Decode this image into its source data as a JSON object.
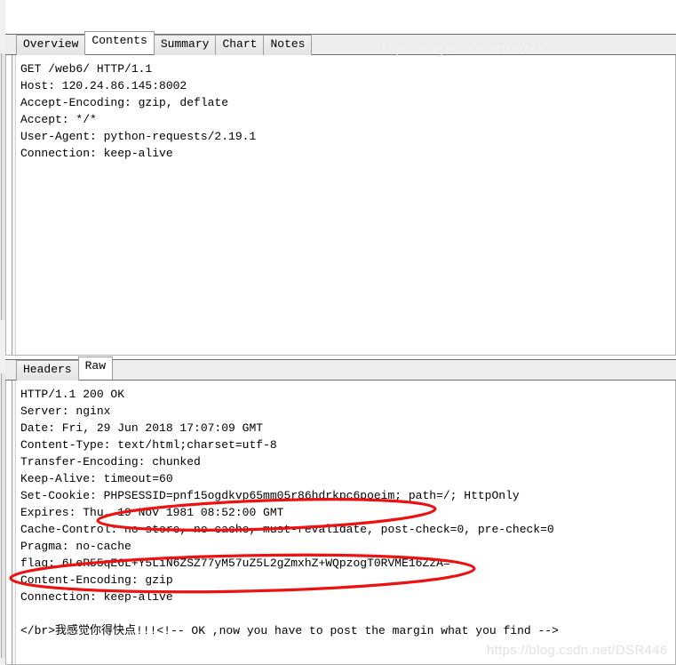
{
  "request_panel": {
    "tabs": [
      {
        "label": "Overview",
        "active": false
      },
      {
        "label": "Contents",
        "active": true
      },
      {
        "label": "Summary",
        "active": false
      },
      {
        "label": "Chart",
        "active": false
      },
      {
        "label": "Notes",
        "active": false
      }
    ],
    "content": "GET /web6/ HTTP/1.1\nHost: 120.24.86.145:8002\nAccept-Encoding: gzip, deflate\nAccept: */*\nUser-Agent: python-requests/2.19.1\nConnection: keep-alive"
  },
  "response_panel": {
    "tabs": [
      {
        "label": "Headers",
        "active": false
      },
      {
        "label": "Raw",
        "active": true
      }
    ],
    "content": "HTTP/1.1 200 OK\nServer: nginx\nDate: Fri, 29 Jun 2018 17:07:09 GMT\nContent-Type: text/html;charset=utf-8\nTransfer-Encoding: chunked\nKeep-Alive: timeout=60\nSet-Cookie: PHPSESSID=pnf15ogdkvp65mm05r86hdrkpc6poeim; path=/; HttpOnly\nExpires: Thu, 19 Nov 1981 08:52:00 GMT\nCache-Control: no-store, no-cache, must-revalidate, post-check=0, pre-check=0\nPragma: no-cache\nflag: 6LeR55qE6L+Y5LiN6ZSZ77yM57uZ5L2gZmxhZ+WQpzogT0RVME16ZzA=\nContent-Encoding: gzip\nConnection: keep-alive\n\n</br>我感觉你得快点!!!<!-- OK ,now you have to post the margin what you find -->"
  },
  "annotations": {
    "highlight_color": "#ee1111",
    "items": [
      {
        "name": "set-cookie-highlight",
        "target": "Set-Cookie: PHPSESSID=pnf15ogdkvp65mm05r86hdrkpc6poeim"
      },
      {
        "name": "flag-highlight",
        "target": "flag: 6LeR55qE6L+Y5LiN6ZSZ77yM57uZ5L2gZmxhZ+WQpzogT0RVME16ZzA="
      }
    ]
  },
  "watermark": {
    "text": "https://blog.csdn.net/DSR446"
  }
}
